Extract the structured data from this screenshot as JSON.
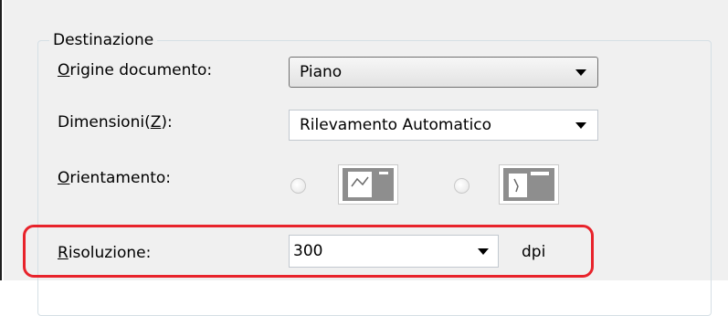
{
  "group": {
    "title": "Destinazione"
  },
  "origine": {
    "label_pre": "",
    "label_ul": "O",
    "label_post": "rigine documento:",
    "value": "Piano"
  },
  "dimensioni": {
    "label_pre": "Dimensioni(",
    "label_ul": "Z",
    "label_post": "):",
    "value": "Rilevamento Automatico"
  },
  "orientamento": {
    "label_pre": "",
    "label_ul": "O",
    "label_post": "rientamento:",
    "options": [
      "portrait-page-icon",
      "landscape-page-icon"
    ]
  },
  "risoluzione": {
    "label_pre": "",
    "label_ul": "R",
    "label_post": "isoluzione:",
    "value": "300",
    "unit": "dpi"
  },
  "colors": {
    "highlight": "#e8232b",
    "panel": "#f0f0f0"
  }
}
